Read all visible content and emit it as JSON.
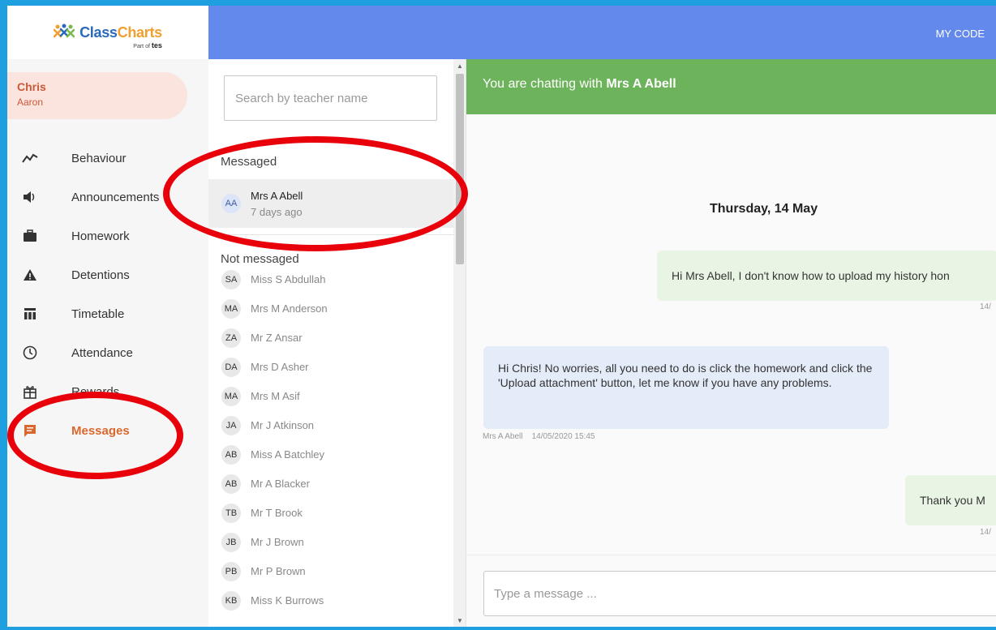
{
  "header": {
    "logo_class": "Class",
    "logo_charts": "Charts",
    "logo_part_of": "Part of",
    "logo_tes": "tes",
    "my_code": "MY CODE"
  },
  "user": {
    "first_name": "Chris",
    "last_name": "Aaron"
  },
  "nav": {
    "items": [
      {
        "label": "Behaviour",
        "icon": "trend-line-icon"
      },
      {
        "label": "Announcements",
        "icon": "speaker-icon"
      },
      {
        "label": "Homework",
        "icon": "briefcase-icon"
      },
      {
        "label": "Detentions",
        "icon": "warning-triangle-icon"
      },
      {
        "label": "Timetable",
        "icon": "table-icon"
      },
      {
        "label": "Attendance",
        "icon": "clock-icon"
      },
      {
        "label": "Rewards",
        "icon": "gift-icon"
      },
      {
        "label": "Messages",
        "icon": "chat-icon",
        "active": true
      }
    ]
  },
  "list": {
    "search_placeholder": "Search by teacher name",
    "messaged_title": "Messaged",
    "messaged": [
      {
        "initials": "AA",
        "name": "Mrs A Abell",
        "time": "7 days ago"
      }
    ],
    "not_messaged_title": "Not messaged",
    "not_messaged": [
      {
        "initials": "SA",
        "name": "Miss S Abdullah"
      },
      {
        "initials": "MA",
        "name": "Mrs M Anderson"
      },
      {
        "initials": "ZA",
        "name": "Mr Z Ansar"
      },
      {
        "initials": "DA",
        "name": "Mrs D Asher"
      },
      {
        "initials": "MA",
        "name": "Mrs M Asif"
      },
      {
        "initials": "JA",
        "name": "Mr J Atkinson"
      },
      {
        "initials": "AB",
        "name": "Miss A Batchley"
      },
      {
        "initials": "AB",
        "name": "Mr A Blacker"
      },
      {
        "initials": "TB",
        "name": "Mr T Brook"
      },
      {
        "initials": "JB",
        "name": "Mr J Brown"
      },
      {
        "initials": "PB",
        "name": "Mr P Brown"
      },
      {
        "initials": "KB",
        "name": "Miss K Burrows"
      }
    ]
  },
  "chat": {
    "header_prefix": "You are chatting with",
    "header_name": "Mrs A Abell",
    "date": "Thursday, 14 May",
    "messages": [
      {
        "text": "Hi Mrs Abell, I don't know how to upload my history hon",
        "meta": "14/"
      },
      {
        "text": "Hi Chris! No worries, all you need to do is click the homework and click the 'Upload attachment' button, let me know if you have any problems.",
        "sender": "Mrs A Abell",
        "timestamp": "14/05/2020 15:45"
      },
      {
        "text": "Thank you M",
        "meta": "14/"
      }
    ],
    "input_placeholder": "Type a message ..."
  },
  "colors": {
    "topbar": "#6489ec",
    "chat_header": "#6db35b",
    "active_nav": "#d9682e",
    "annotation": "#e8000a",
    "frame_border": "#1ea0e0"
  }
}
